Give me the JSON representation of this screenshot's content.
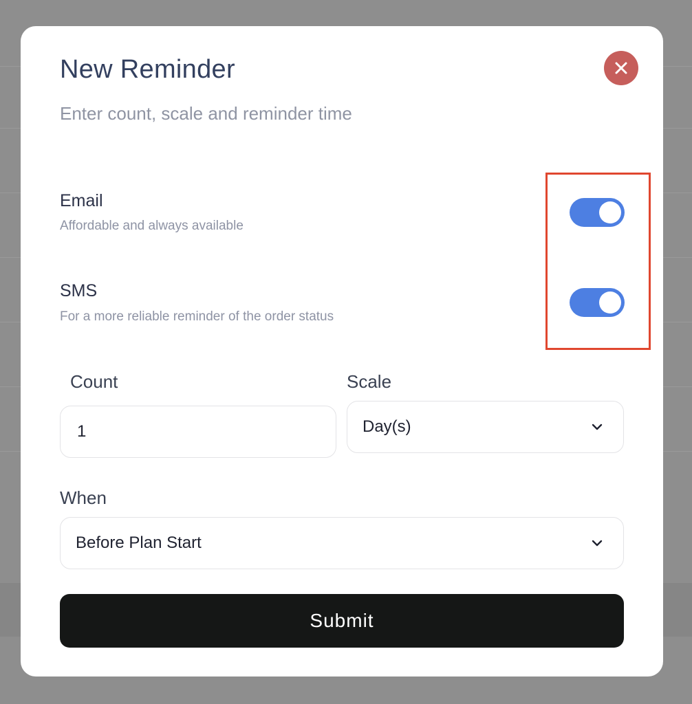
{
  "modal": {
    "title": "New Reminder",
    "subtitle": "Enter count, scale and reminder time"
  },
  "options": [
    {
      "label": "Email",
      "description": "Affordable and always available",
      "enabled": true
    },
    {
      "label": "SMS",
      "description": "For a more reliable reminder of the order status",
      "enabled": true
    }
  ],
  "count": {
    "label": "Count",
    "value": "1"
  },
  "scale": {
    "label": "Scale",
    "selected": "Day(s)"
  },
  "when": {
    "label": "When",
    "selected": "Before Plan Start"
  },
  "submit_label": "Submit",
  "colors": {
    "accent": "#4d7fe2",
    "close_button": "#c65e5b",
    "highlight": "#e0472f",
    "submit_button": "#151716"
  },
  "icons": {
    "close": "close-icon",
    "dropdown": "chevron-down-icon"
  }
}
